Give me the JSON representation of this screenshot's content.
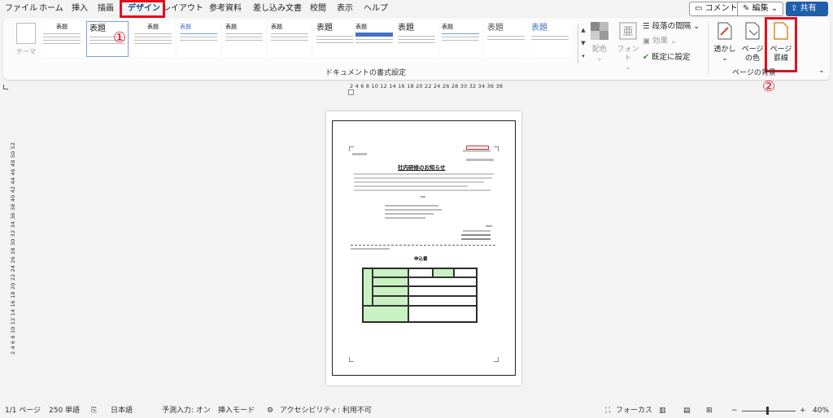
{
  "menu": {
    "items": [
      "ファイル",
      "ホーム",
      "挿入",
      "描画",
      "デザイン",
      "レイアウト",
      "参考資料",
      "差し込み文書",
      "校閲",
      "表示",
      "ヘルプ"
    ],
    "active": "デザイン",
    "comment_label": "コメント",
    "edit_label": "編集",
    "share_label": "共有"
  },
  "ribbon": {
    "theme_label": "テーマ",
    "styles": [
      {
        "title": "表題"
      },
      {
        "title": "表題"
      },
      {
        "title": "表題"
      },
      {
        "title": "表題"
      },
      {
        "title": "表題"
      },
      {
        "title": "表題"
      },
      {
        "title": "表題"
      },
      {
        "title": "表題"
      },
      {
        "title": "表題"
      },
      {
        "title": "表題"
      },
      {
        "title": "表題"
      },
      {
        "title": "表題"
      }
    ],
    "colors_label": "配色",
    "fonts_label": "フォント",
    "paragraph_spacing_label": "段落の間隔",
    "effects_label": "効果",
    "set_default_label": "既定に設定",
    "watermark_label_1": "透かし",
    "page_color_label_1": "ページ",
    "page_color_label_2": "の色",
    "page_borders_label_1": "ページ",
    "page_borders_label_2": "罫線",
    "group_document_formatting": "ドキュメントの書式設定",
    "group_page_background": "ページの背景",
    "annotation_1": "①",
    "annotation_2": "②"
  },
  "rulers": {
    "horizontal": "2 4 6 8 10 12 14 16 18 20 22 24 26 28 30 32 34 36 38",
    "vertical": "2 4 6 8 10 12 14 16 18 20 22 24 26 28 30 32 34 36 38 40 42 44 46 48 50 52"
  },
  "document": {
    "title": "社内研修のお知らせ",
    "form_title": "申込書"
  },
  "status": {
    "page": "1/1 ページ",
    "words": "250 単語",
    "language": "日本語",
    "predictive": "予測入力: オン",
    "insert_mode": "挿入モード",
    "accessibility": "アクセシビリティ: 利用不可",
    "focus": "フォーカス",
    "zoom_minus": "−",
    "zoom_plus": "+",
    "zoom": "40%"
  }
}
